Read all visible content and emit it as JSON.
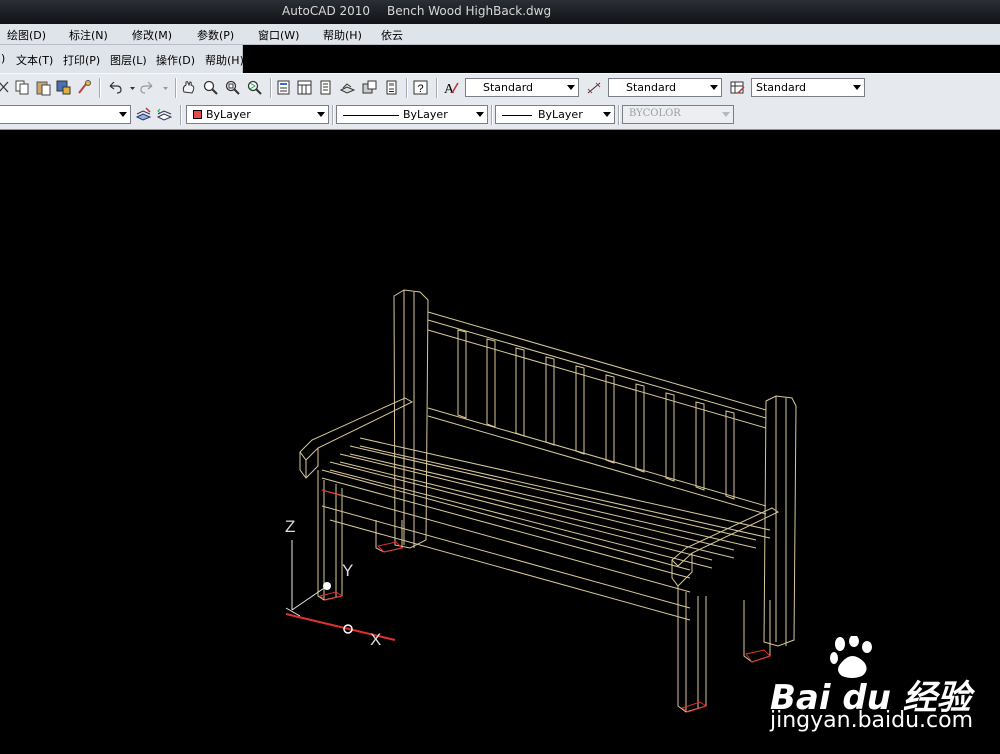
{
  "window": {
    "app_title": "AutoCAD 2010",
    "file_name": "Bench Wood HighBack.dwg"
  },
  "menu": {
    "row1": [
      "绘图(D)",
      "标注(N)",
      "修改(M)",
      "参数(P)",
      "窗口(W)",
      "帮助(H)",
      "依云"
    ],
    "row2": [
      ")",
      "文本(T)",
      "打印(P)",
      "图层(L)",
      "操作(D)",
      "帮助(H)"
    ]
  },
  "toolbar_styles": {
    "text_style": "Standard",
    "dim_style": "Standard",
    "table_style": "Standard"
  },
  "properties": {
    "color": "ByLayer",
    "linetype": "ByLayer",
    "lineweight": "ByLayer",
    "plot_style": "BYCOLOR",
    "color_hex": "#e74c4c"
  },
  "ucs": {
    "z_label": "Z",
    "y_label": "Y",
    "x_label": "X"
  },
  "watermark": {
    "brand": "Bai du 经验",
    "url": "jingyan.baidu.com"
  },
  "colors": {
    "wireframe": "#d9c89a",
    "ucs_x": "#e03030"
  }
}
